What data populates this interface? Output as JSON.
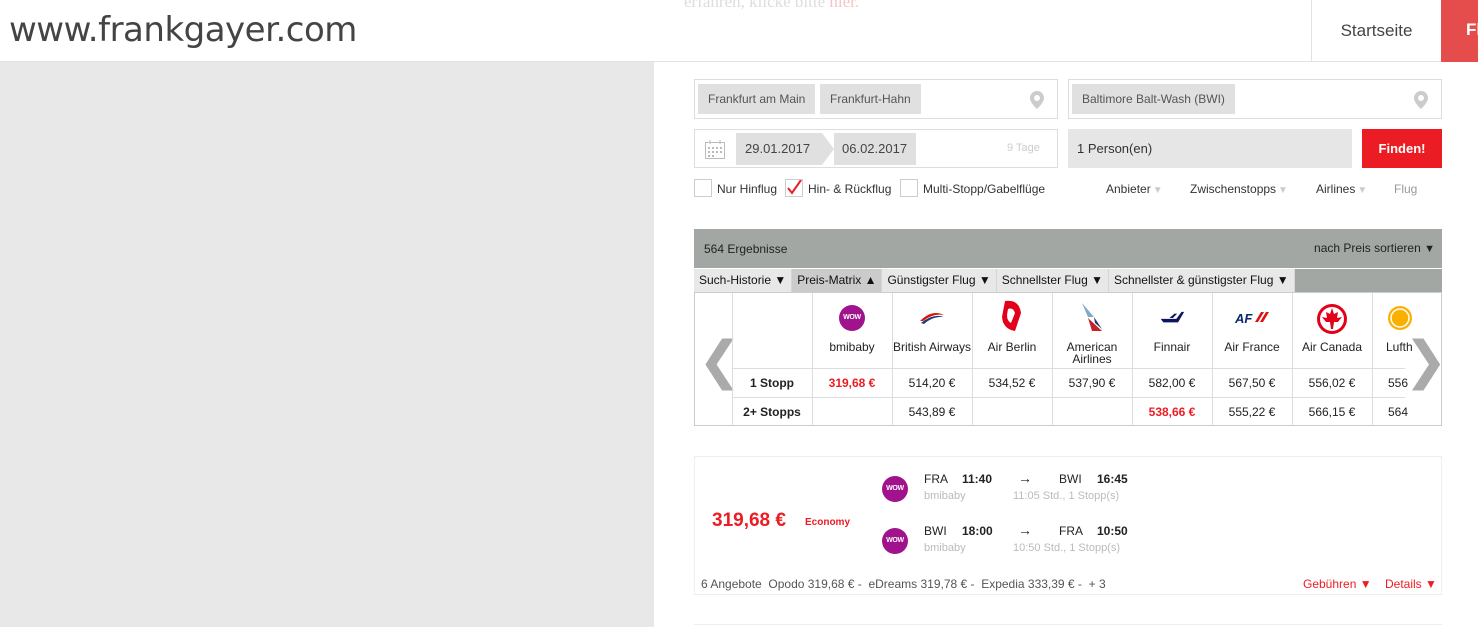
{
  "header": {
    "logo": "www.frankgayer.com",
    "bg_text_a": "erfahren, klicke bitte ",
    "bg_text_link": "hier",
    "bg_text_b": ".",
    "nav_start": "Startseite",
    "nav_active": "Fl"
  },
  "search": {
    "origin_chips": [
      "Frankfurt am Main",
      "Frankfurt-Hahn"
    ],
    "destination_chip": "Baltimore Balt-Wash (BWI)",
    "date_from": "29.01.2017",
    "date_to": "06.02.2017",
    "days": "9 Tage",
    "persons": "1 Person(en)",
    "find_button": "Finden!",
    "trip_options": [
      {
        "label": "Nur Hinflug",
        "checked": false
      },
      {
        "label": "Hin- & Rückflug",
        "checked": true
      },
      {
        "label": "Multi-Stopp/Gabelflüge",
        "checked": false
      }
    ],
    "filters": [
      "Anbieter",
      "Zwischenstopps",
      "Airlines",
      "Flug"
    ]
  },
  "results": {
    "count": "564 Ergebnisse",
    "sort": "nach Preis sortieren",
    "sort_arrow": "▼",
    "tabs": [
      {
        "label": "Such-Historie ▼",
        "active": false
      },
      {
        "label": "Preis-Matrix ▲",
        "active": true
      },
      {
        "label": "Günstigster Flug ▼",
        "active": false
      },
      {
        "label": "Schnellster Flug ▼",
        "active": false
      },
      {
        "label": "Schnellster & günstigster Flug ▼",
        "active": false
      }
    ]
  },
  "matrix": {
    "prev": "❮",
    "next": "❯",
    "row_labels": [
      "1 Stopp",
      "2+ Stopps"
    ],
    "airlines": [
      {
        "name": "bmibaby",
        "icon": "wow-logo-icon",
        "stop1": "319,68 €",
        "stop1_red": true,
        "stop2": "",
        "stop2_red": false
      },
      {
        "name": "British Airways",
        "icon": "british-airways-logo-icon",
        "stop1": "514,20 €",
        "stop1_red": false,
        "stop2": "543,89 €",
        "stop2_red": false
      },
      {
        "name": "Air Berlin",
        "icon": "air-berlin-logo-icon",
        "stop1": "534,52 €",
        "stop1_red": false,
        "stop2": "",
        "stop2_red": false
      },
      {
        "name": "American Airlines",
        "icon": "american-airlines-logo-icon",
        "stop1": "537,90 €",
        "stop1_red": false,
        "stop2": "",
        "stop2_red": false
      },
      {
        "name": "Finnair",
        "icon": "finnair-logo-icon",
        "stop1": "582,00 €",
        "stop1_red": false,
        "stop2": "538,66 €",
        "stop2_red": true
      },
      {
        "name": "Air France",
        "icon": "air-france-logo-icon",
        "stop1": "567,50 €",
        "stop1_red": false,
        "stop2": "555,22 €",
        "stop2_red": false
      },
      {
        "name": "Air Canada",
        "icon": "air-canada-logo-icon",
        "stop1": "556,02 €",
        "stop1_red": false,
        "stop2": "566,15 €",
        "stop2_red": false
      },
      {
        "name": "Lufthansa",
        "icon": "lufthansa-logo-icon",
        "stop1": "556",
        "stop1_red": false,
        "stop2": "564",
        "stop2_red": false
      }
    ]
  },
  "result_card": {
    "price": "319,68 €",
    "class": "Economy",
    "logo_text": "WOW",
    "outbound": {
      "from": "FRA",
      "dep": "11:40",
      "arrow": "→",
      "to": "BWI",
      "arr": "16:45",
      "airline": "bmibaby",
      "info": "11:05 Std., 1 Stopp(s)"
    },
    "inbound": {
      "from": "BWI",
      "dep": "18:00",
      "arrow": "→",
      "to": "FRA",
      "arr": "10:50",
      "airline": "bmibaby",
      "info": "10:50 Std., 1 Stopp(s)"
    },
    "offers": "6 Angebote  Opodo 319,68 € -  eDreams 319,78 € -  Expedia 333,39 € -  + 3",
    "fees_link": "Gebühren ▼",
    "details_link": "Details ▼"
  },
  "colors": {
    "accent": "#ec1c24",
    "nav_red": "#e54c4c",
    "bar_gray": "#a3a7a3",
    "wow_purple": "#a0138d"
  }
}
